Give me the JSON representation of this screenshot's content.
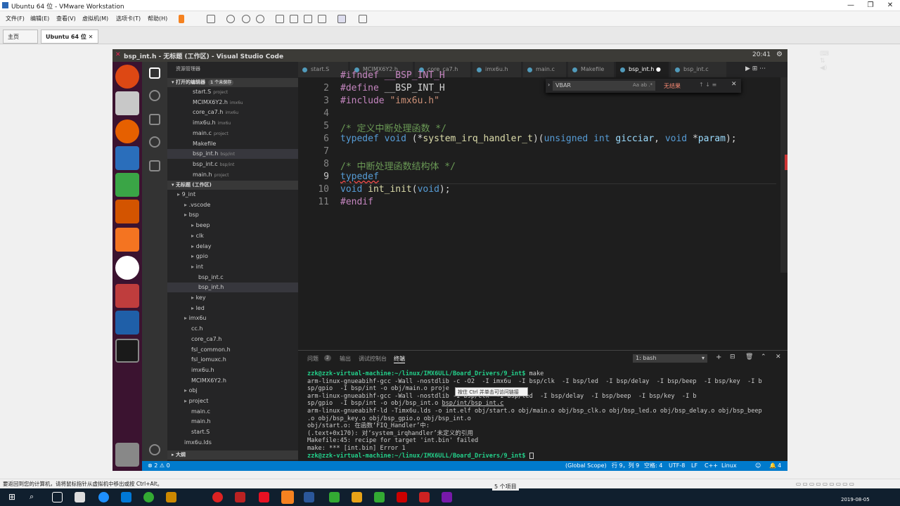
{
  "vmware": {
    "title": "Ubuntu 64 位 - VMware Workstation",
    "menus": [
      "文件(F)",
      "编辑(E)",
      "查看(V)",
      "虚拟机(M)",
      "选项卡(T)",
      "帮助(H)"
    ],
    "tabs": [
      "主页",
      "Ubuntu 64 位"
    ],
    "status_text": "要返回到您的计算机，请将鼠标指针从虚拟机中移出或按 Ctrl+Alt。"
  },
  "vscode": {
    "title": "bsp_int.h - 无标题 (工作区) - Visual Studio Code",
    "clock": "20:41",
    "explorer_header": "资源管理器",
    "open_editors_header": "打开的编辑器",
    "unsaved_badge": "1 个未保存",
    "open_editors": [
      {
        "name": "start.S",
        "dir": "project"
      },
      {
        "name": "MCIMX6Y2.h",
        "dir": "imx6u"
      },
      {
        "name": "core_ca7.h",
        "dir": "imx6u"
      },
      {
        "name": "imx6u.h",
        "dir": "imx6u"
      },
      {
        "name": "main.c",
        "dir": "project"
      },
      {
        "name": "Makefile",
        "dir": ""
      },
      {
        "name": "bsp_int.h",
        "dir": "bsp/int"
      },
      {
        "name": "bsp_int.c",
        "dir": "bsp/int"
      },
      {
        "name": "main.h",
        "dir": "project"
      }
    ],
    "workspace_header": "无标题 (工作区)",
    "tree": [
      "9_int",
      ".vscode",
      "bsp",
      "beep",
      "clk",
      "delay",
      "gpio",
      "int",
      "bsp_int.c",
      "bsp_int.h",
      "key",
      "led",
      "imx6u",
      "cc.h",
      "core_ca7.h",
      "fsl_common.h",
      "fsl_iomuxc.h",
      "imx6u.h",
      "MCIMX6Y2.h",
      "obj",
      "project",
      "main.c",
      "main.h",
      "start.S",
      "imx6u.lds"
    ],
    "outline_header": "大纲",
    "editor_tabs": [
      "start.S",
      "MCIMX6Y2.h",
      "core_ca7.h",
      "imx6u.h",
      "main.c",
      "Makefile",
      "bsp_int.h",
      "bsp_int.c"
    ],
    "find": {
      "value": "VBAR",
      "opts": "Aa  ab  .*",
      "result": "无结果"
    },
    "code": {
      "l1": "#ifndef __BSP_INT_H",
      "l2a": "#define",
      "l2b": " __BSP_INT_H",
      "l3a": "#include",
      "l3b": " \"imx6u.h\"",
      "l5": "/* 定义中断处理函数 */",
      "l6_typedef": "typedef",
      "l6_void": " void ",
      "l6_p1": "(*",
      "l6_fn": "system_irq_handler_t",
      "l6_p2": ")(",
      "l6_u": "unsigned int ",
      "l6_g": "gicciar",
      "l6_c": ", ",
      "l6_v": "void ",
      "l6_s": "*",
      "l6_param": "param",
      "l6_end": ");",
      "l8": "/* 中断处理函数结构体 */",
      "l9": "typedef",
      "l10_void": "void ",
      "l10_fn": "int_init",
      "l10_p": "(",
      "l10_v": "void",
      "l10_end": ");",
      "l11": "#endif"
    },
    "line_numbers": [
      "2",
      "3",
      "4",
      "5",
      "6",
      "7",
      "8",
      "9",
      "10",
      "11"
    ],
    "panel_tabs": [
      "问题",
      "输出",
      "调试控制台",
      "终端"
    ],
    "problems_count": "2",
    "terminal_select": "1: bash",
    "terminal": {
      "prompt": "zzk@zzk-virtual-machine:~/linux/IMX6ULL/Board_Drivers/9_int$",
      "cmd": " make",
      "o1": "arm-linux-gnueabihf-gcc -Wall -nostdlib -c -O2  -I imx6u  -I bsp/clk  -I bsp/led  -I bsp/delay  -I bsp/beep  -I bsp/key  -I b",
      "o2": "sp/gpio  -I bsp/int -o obj/main.o proje",
      "o3": "arm-linux-gnueabihf-gcc -Wall -nostdlib",
      "o3b": " -I bsp/clk  -I bsp/led  -I bsp/delay  -I bsp/beep  -I bsp/key  -I b",
      "o4": "sp/gpio  -I bsp/int -o obj/bsp_int.o ",
      "o4link": "bsp/int/bsp_int.c",
      "o5": "arm-linux-gnueabihf-ld -Timx6u.lds -o int.elf obj/start.o obj/main.o obj/bsp_clk.o obj/bsp_led.o obj/bsp_delay.o obj/bsp_beep",
      "o6": ".o obj/bsp_key.o obj/bsp_gpio.o obj/bsp_int.o",
      "o7": "obj/start.o: 在函数‘FIQ_Handler’中:",
      "o8": "(.text+0x170): 对‘system_irqhandler’未定义的引用",
      "o9": "Makefile:45: recipe for target 'int.bin' failed",
      "o10": "make: *** [int.bin] Error 1"
    },
    "tooltip": "按住 Ctrl 并单击可访问链接",
    "status": {
      "errors": "⊗ 2 ⚠ 0",
      "scope": "(Global Scope)",
      "pos": "行 9，列 9",
      "spaces": "空格: 4",
      "enc": "UTF-8",
      "eol": "LF",
      "lang": "C++",
      "os": "Linux",
      "bell": "4"
    }
  },
  "taskbar": {
    "items_label": "5 个项目",
    "date": "2019-08-05"
  }
}
